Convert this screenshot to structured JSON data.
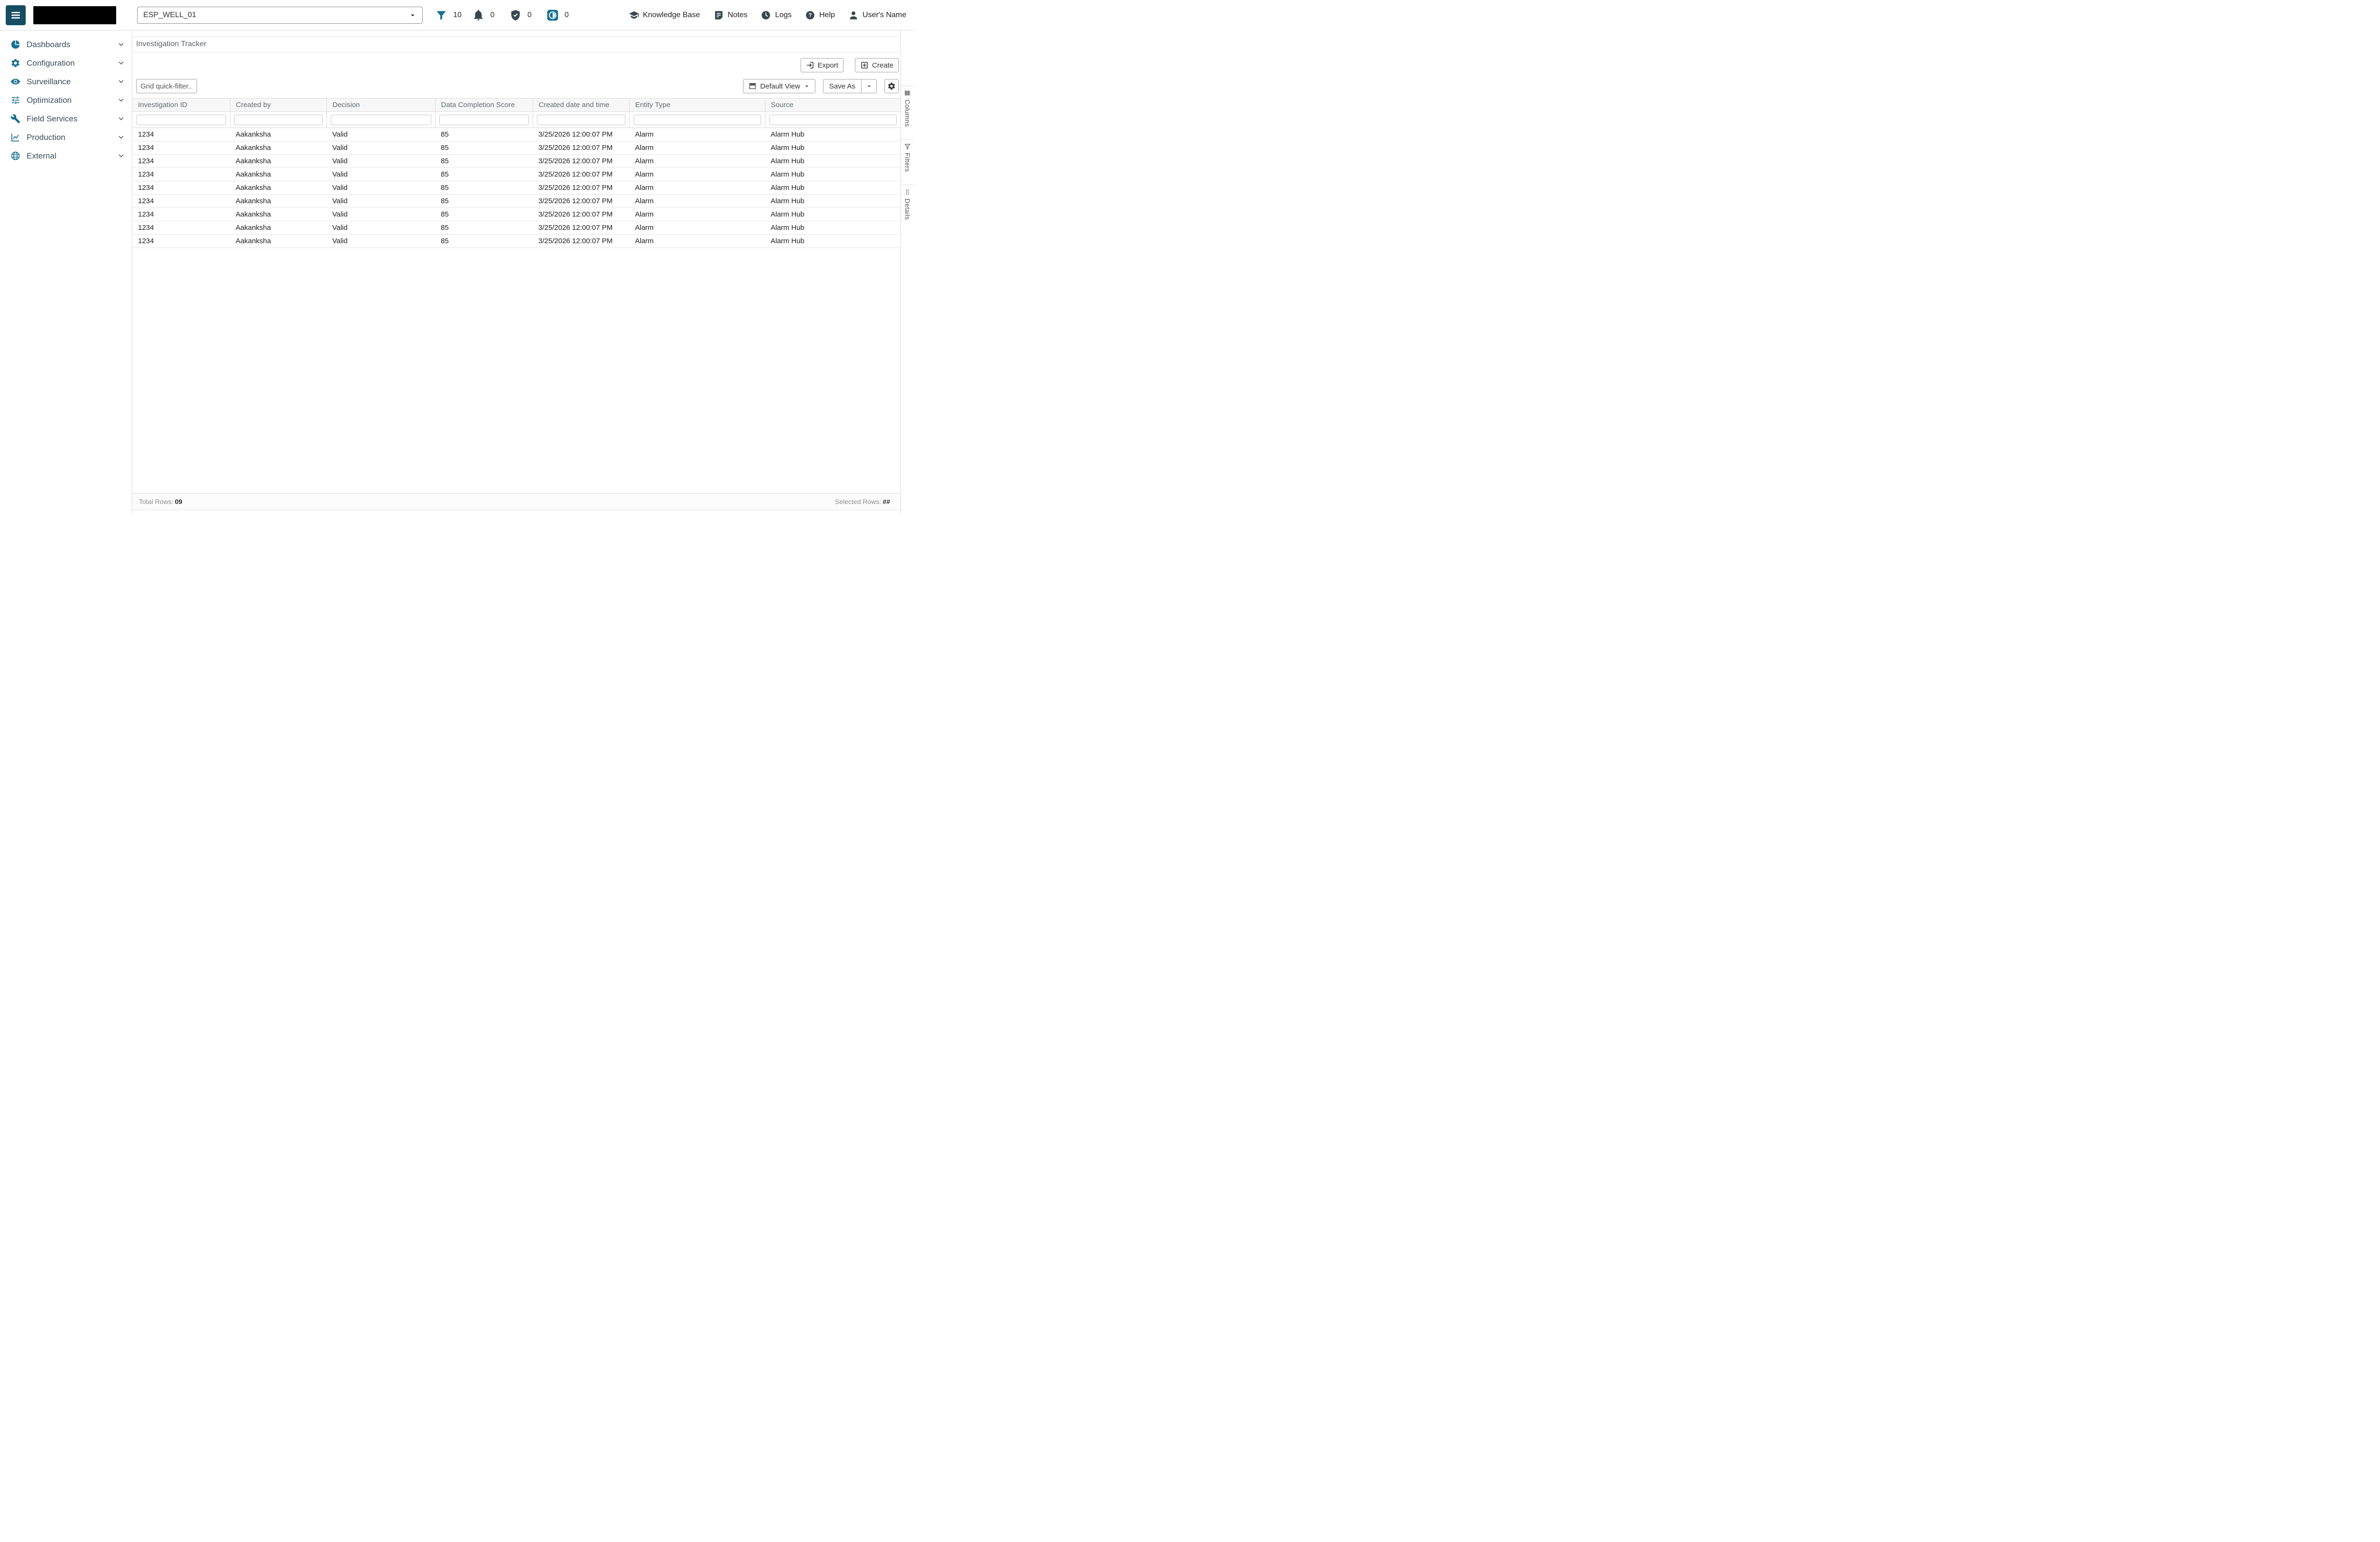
{
  "colors": {
    "accent_teal": "#17708f",
    "dark_teal": "#164d63",
    "icon_dark": "#37474f"
  },
  "topbar": {
    "well_selector": {
      "value": "ESP_WELL_01"
    },
    "counters": [
      {
        "name": "filters",
        "icon": "filter-icon",
        "value": "10",
        "color": "#17708f"
      },
      {
        "name": "alarms",
        "icon": "bell-icon",
        "value": "0",
        "color": "#37474f"
      },
      {
        "name": "validations",
        "icon": "shield-check-icon",
        "value": "0",
        "color": "#37474f"
      },
      {
        "name": "events",
        "icon": "events-icon",
        "value": "0",
        "color": "#17708f"
      }
    ],
    "links": [
      {
        "name": "knowledge-base",
        "icon": "graduation-cap-icon",
        "label": "Knowledge Base"
      },
      {
        "name": "notes",
        "icon": "notes-icon",
        "label": "Notes"
      },
      {
        "name": "logs",
        "icon": "clock-icon",
        "label": "Logs"
      },
      {
        "name": "help",
        "icon": "help-icon",
        "label": "Help"
      },
      {
        "name": "user",
        "icon": "user-icon",
        "label": "User's Name"
      }
    ]
  },
  "sidebar": {
    "items": [
      {
        "name": "dashboards",
        "icon": "dashboard-icon",
        "label": "Dashboards"
      },
      {
        "name": "configuration",
        "icon": "gear-icon",
        "label": "Configuration"
      },
      {
        "name": "surveillance",
        "icon": "eye-icon",
        "label": "Surveillance"
      },
      {
        "name": "optimization",
        "icon": "sliders-icon",
        "label": "Optimization"
      },
      {
        "name": "field-services",
        "icon": "wrench-icon",
        "label": "Field Services"
      },
      {
        "name": "production",
        "icon": "chart-icon",
        "label": "Production"
      },
      {
        "name": "external",
        "icon": "globe-icon",
        "label": "External"
      }
    ]
  },
  "main": {
    "title": "Investigation Tracker",
    "actions": {
      "export_label": "Export",
      "create_label": "Create"
    },
    "toolbar": {
      "quick_filter_placeholder": "Grid quick-filter...",
      "view_selector": "Default View",
      "save_as_label": "Save As"
    },
    "table": {
      "columns": [
        "Investigation ID",
        "Created by",
        "Decision",
        "Data Completion Score",
        "Created date and time",
        "Entity Type",
        "Source"
      ],
      "rows": [
        [
          "1234",
          "Aakanksha",
          "Valid",
          "85",
          "3/25/2026 12:00:07 PM",
          "Alarm",
          "Alarm Hub"
        ],
        [
          "1234",
          "Aakanksha",
          "Valid",
          "85",
          "3/25/2026 12:00:07 PM",
          "Alarm",
          "Alarm Hub"
        ],
        [
          "1234",
          "Aakanksha",
          "Valid",
          "85",
          "3/25/2026 12:00:07 PM",
          "Alarm",
          "Alarm Hub"
        ],
        [
          "1234",
          "Aakanksha",
          "Valid",
          "85",
          "3/25/2026 12:00:07 PM",
          "Alarm",
          "Alarm Hub"
        ],
        [
          "1234",
          "Aakanksha",
          "Valid",
          "85",
          "3/25/2026 12:00:07 PM",
          "Alarm",
          "Alarm Hub"
        ],
        [
          "1234",
          "Aakanksha",
          "Valid",
          "85",
          "3/25/2026 12:00:07 PM",
          "Alarm",
          "Alarm Hub"
        ],
        [
          "1234",
          "Aakanksha",
          "Valid",
          "85",
          "3/25/2026 12:00:07 PM",
          "Alarm",
          "Alarm Hub"
        ],
        [
          "1234",
          "Aakanksha",
          "Valid",
          "85",
          "3/25/2026 12:00:07 PM",
          "Alarm",
          "Alarm Hub"
        ],
        [
          "1234",
          "Aakanksha",
          "Valid",
          "85",
          "3/25/2026 12:00:07 PM",
          "Alarm",
          "Alarm Hub"
        ]
      ]
    },
    "status_bar": {
      "total_rows_label": "Total Rows:",
      "total_rows_value": "09",
      "selected_rows_label": "Selected Rows:",
      "selected_rows_value": "##"
    }
  },
  "side_tabs": [
    {
      "name": "columns",
      "icon": "columns-icon",
      "label": "Columns"
    },
    {
      "name": "filters",
      "icon": "filter-outline-icon",
      "label": "Filters"
    },
    {
      "name": "details",
      "icon": "details-icon",
      "label": "Details"
    }
  ]
}
